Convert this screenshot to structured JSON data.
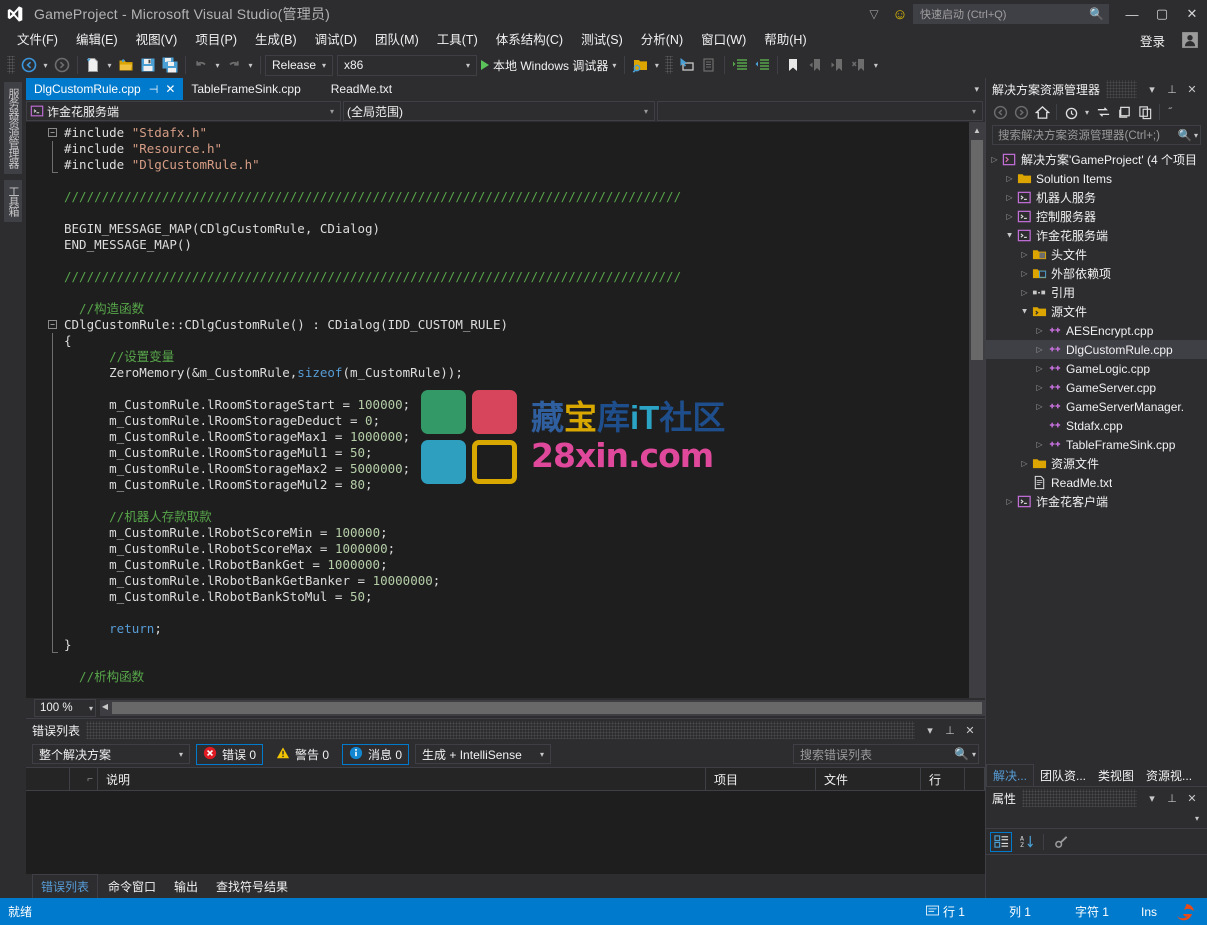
{
  "window": {
    "title": "GameProject - Microsoft Visual Studio(管理员)",
    "logo_name": "visual-studio-logo",
    "minimize": "—",
    "maximize": "▢",
    "close": "✕",
    "feedback_icon": "▽",
    "smiley_icon": "☺"
  },
  "quick_launch": {
    "placeholder": "快速启动 (Ctrl+Q)",
    "icon": "search-icon"
  },
  "menu": {
    "items": [
      "文件(F)",
      "编辑(E)",
      "视图(V)",
      "项目(P)",
      "生成(B)",
      "调试(D)",
      "团队(M)",
      "工具(T)",
      "体系结构(C)",
      "测试(S)",
      "分析(N)",
      "窗口(W)",
      "帮助(H)"
    ],
    "sign_in": "登录"
  },
  "toolbar": {
    "back_icon": "navigate-back-icon",
    "forward_icon": "navigate-forward-icon",
    "new_item_icon": "new-item-icon",
    "open_icon": "open-file-icon",
    "save_icon": "save-icon",
    "save_all_icon": "save-all-icon",
    "undo_icon": "undo-icon",
    "redo_icon": "redo-icon",
    "configuration": "Release",
    "platform": "x86",
    "run_label": "本地 Windows 调试器",
    "find_icon": "find-in-files-icon",
    "cursor_icon": "pointer-select-icon",
    "clipboard_icon": "clipboard-icon",
    "indent_icon": "increase-indent-icon",
    "outdent_icon": "decrease-indent-icon",
    "bookmark_icon": "bookmark-icon",
    "prev_bookmark_icon": "previous-bookmark-icon",
    "next_bookmark_icon": "next-bookmark-icon",
    "clear_bookmark_icon": "clear-bookmarks-icon"
  },
  "left_strip": {
    "tabs": [
      "服务器资源管理器",
      "工具箱"
    ]
  },
  "editor": {
    "tabs": [
      {
        "label": "DlgCustomRule.cpp",
        "active": true,
        "pin": "⊣",
        "close": "✕"
      },
      {
        "label": "TableFrameSink.cpp",
        "active": false
      },
      {
        "label": "ReadMe.txt",
        "active": false
      }
    ],
    "nav_project": "诈金花服务端",
    "nav_scope": "(全局范围)",
    "zoom": "100 %",
    "code_lines": [
      {
        "tokens": [
          {
            "t": "#include ",
            "c": "pp"
          },
          {
            "t": "\"Stdafx.h\"",
            "c": "str"
          }
        ],
        "fold": "open"
      },
      {
        "tokens": [
          {
            "t": "#include ",
            "c": "pp"
          },
          {
            "t": "\"Resource.h\"",
            "c": "str"
          }
        ],
        "bar": true
      },
      {
        "tokens": [
          {
            "t": "#include ",
            "c": "pp"
          },
          {
            "t": "\"DlgCustomRule.h\"",
            "c": "str"
          }
        ],
        "bar": true,
        "barend": true
      },
      {
        "tokens": []
      },
      {
        "tokens": [
          {
            "t": "//////////////////////////////////////////////////////////////////////////////////",
            "c": "com"
          }
        ]
      },
      {
        "tokens": []
      },
      {
        "tokens": [
          {
            "t": "BEGIN_MESSAGE_MAP(CDlgCustomRule, CDialog)",
            "c": "id"
          }
        ]
      },
      {
        "tokens": [
          {
            "t": "END_MESSAGE_MAP()",
            "c": "id"
          }
        ]
      },
      {
        "tokens": []
      },
      {
        "tokens": [
          {
            "t": "//////////////////////////////////////////////////////////////////////////////////",
            "c": "com"
          }
        ]
      },
      {
        "tokens": []
      },
      {
        "tokens": [
          {
            "t": "  //构造函数",
            "c": "com"
          }
        ]
      },
      {
        "tokens": [
          {
            "t": "CDlgCustomRule::CDlgCustomRule() : CDialog(IDD_CUSTOM_RULE)",
            "c": "id"
          }
        ],
        "fold": "open"
      },
      {
        "tokens": [
          {
            "t": "{",
            "c": "id"
          }
        ],
        "bar": true
      },
      {
        "tokens": [
          {
            "t": "      //设置变量",
            "c": "com"
          }
        ],
        "bar": true
      },
      {
        "tokens": [
          {
            "t": "      ZeroMemory(&m_CustomRule,",
            "c": "id"
          },
          {
            "t": "sizeof",
            "c": "kw"
          },
          {
            "t": "(m_CustomRule));",
            "c": "id"
          }
        ],
        "bar": true
      },
      {
        "tokens": [],
        "bar": true
      },
      {
        "tokens": [
          {
            "t": "      m_CustomRule.lRoomStorageStart = ",
            "c": "id"
          },
          {
            "t": "100000",
            "c": "num"
          },
          {
            "t": ";",
            "c": "id"
          }
        ],
        "bar": true
      },
      {
        "tokens": [
          {
            "t": "      m_CustomRule.lRoomStorageDeduct = ",
            "c": "id"
          },
          {
            "t": "0",
            "c": "num"
          },
          {
            "t": ";",
            "c": "id"
          }
        ],
        "bar": true
      },
      {
        "tokens": [
          {
            "t": "      m_CustomRule.lRoomStorageMax1 = ",
            "c": "id"
          },
          {
            "t": "1000000",
            "c": "num"
          },
          {
            "t": ";",
            "c": "id"
          }
        ],
        "bar": true
      },
      {
        "tokens": [
          {
            "t": "      m_CustomRule.lRoomStorageMul1 = ",
            "c": "id"
          },
          {
            "t": "50",
            "c": "num"
          },
          {
            "t": ";",
            "c": "id"
          }
        ],
        "bar": true
      },
      {
        "tokens": [
          {
            "t": "      m_CustomRule.lRoomStorageMax2 = ",
            "c": "id"
          },
          {
            "t": "5000000",
            "c": "num"
          },
          {
            "t": ";",
            "c": "id"
          }
        ],
        "bar": true
      },
      {
        "tokens": [
          {
            "t": "      m_CustomRule.lRoomStorageMul2 = ",
            "c": "id"
          },
          {
            "t": "80",
            "c": "num"
          },
          {
            "t": ";",
            "c": "id"
          }
        ],
        "bar": true
      },
      {
        "tokens": [],
        "bar": true
      },
      {
        "tokens": [
          {
            "t": "      //机器人存款取款",
            "c": "com"
          }
        ],
        "bar": true
      },
      {
        "tokens": [
          {
            "t": "      m_CustomRule.lRobotScoreMin = ",
            "c": "id"
          },
          {
            "t": "100000",
            "c": "num"
          },
          {
            "t": ";",
            "c": "id"
          }
        ],
        "bar": true
      },
      {
        "tokens": [
          {
            "t": "      m_CustomRule.lRobotScoreMax = ",
            "c": "id"
          },
          {
            "t": "1000000",
            "c": "num"
          },
          {
            "t": ";",
            "c": "id"
          }
        ],
        "bar": true
      },
      {
        "tokens": [
          {
            "t": "      m_CustomRule.lRobotBankGet = ",
            "c": "id"
          },
          {
            "t": "1000000",
            "c": "num"
          },
          {
            "t": ";",
            "c": "id"
          }
        ],
        "bar": true
      },
      {
        "tokens": [
          {
            "t": "      m_CustomRule.lRobotBankGetBanker = ",
            "c": "id"
          },
          {
            "t": "10000000",
            "c": "num"
          },
          {
            "t": ";",
            "c": "id"
          }
        ],
        "bar": true
      },
      {
        "tokens": [
          {
            "t": "      m_CustomRule.lRobotBankStoMul = ",
            "c": "id"
          },
          {
            "t": "50",
            "c": "num"
          },
          {
            "t": ";",
            "c": "id"
          }
        ],
        "bar": true
      },
      {
        "tokens": [],
        "bar": true
      },
      {
        "tokens": [
          {
            "t": "      ",
            "c": "id"
          },
          {
            "t": "return",
            "c": "kw"
          },
          {
            "t": ";",
            "c": "id"
          }
        ],
        "bar": true
      },
      {
        "tokens": [
          {
            "t": "}",
            "c": "id"
          }
        ],
        "bar": true,
        "barend": true
      },
      {
        "tokens": []
      },
      {
        "tokens": [
          {
            "t": "  //析构函数",
            "c": "com"
          }
        ]
      }
    ]
  },
  "watermark": {
    "line1_parts": [
      {
        "text": "藏",
        "color": "#2f5f9e"
      },
      {
        "text": "宝",
        "color": "#d8a800"
      },
      {
        "text": "库",
        "color": "#1f4e8c"
      },
      {
        "text": "iT",
        "color": "#2aa3c4"
      },
      {
        "text": "社区",
        "color": "#1f4e8c"
      }
    ],
    "line2": "28xin.com",
    "line2_color": "#e0499b",
    "squares": [
      "#339966",
      "#d6455c",
      "#2f9fc0",
      "#d8a800"
    ]
  },
  "solution_explorer": {
    "title": "解决方案资源管理器",
    "search_placeholder": "搜索解决方案资源管理器(Ctrl+;)",
    "dropdown_icon": "chevron-down-icon",
    "pin_icon": "pin-icon",
    "close_icon": "close-icon",
    "toolbar_icons": [
      "back-icon",
      "forward-icon",
      "home-icon",
      "pending-changes-icon",
      "sync-with-active-document-icon",
      "refresh-icon",
      "show-all-files-icon",
      "properties-icon",
      "overflow-icon"
    ],
    "tree": [
      {
        "indent": 0,
        "twisty": "▷",
        "icon": "solution-icon",
        "label": "解决方案'GameProject' (4 个项目"
      },
      {
        "indent": 1,
        "twisty": "▷",
        "icon": "folder-icon",
        "label": "Solution Items"
      },
      {
        "indent": 1,
        "twisty": "▷",
        "icon": "cpp-project-icon",
        "label": "机器人服务"
      },
      {
        "indent": 1,
        "twisty": "▷",
        "icon": "cpp-project-icon",
        "label": "控制服务器"
      },
      {
        "indent": 1,
        "twisty": "▲",
        "icon": "cpp-project-icon",
        "label": "诈金花服务端"
      },
      {
        "indent": 2,
        "twisty": "▷",
        "icon": "header-folder-icon",
        "label": "头文件"
      },
      {
        "indent": 2,
        "twisty": "▷",
        "icon": "ext-deps-icon",
        "label": "外部依赖项"
      },
      {
        "indent": 2,
        "twisty": "▷",
        "icon": "references-icon",
        "label": "引用"
      },
      {
        "indent": 2,
        "twisty": "▲",
        "icon": "source-folder-icon",
        "label": "源文件"
      },
      {
        "indent": 3,
        "twisty": "▷",
        "icon": "cpp-file-icon",
        "label": "AESEncrypt.cpp"
      },
      {
        "indent": 3,
        "twisty": "▷",
        "icon": "cpp-file-icon",
        "label": "DlgCustomRule.cpp",
        "selected": true
      },
      {
        "indent": 3,
        "twisty": "▷",
        "icon": "cpp-file-icon",
        "label": "GameLogic.cpp"
      },
      {
        "indent": 3,
        "twisty": "▷",
        "icon": "cpp-file-icon",
        "label": "GameServer.cpp"
      },
      {
        "indent": 3,
        "twisty": "▷",
        "icon": "cpp-file-icon",
        "label": "GameServerManager."
      },
      {
        "indent": 3,
        "twisty": "",
        "icon": "cpp-file-icon",
        "label": "Stdafx.cpp"
      },
      {
        "indent": 3,
        "twisty": "▷",
        "icon": "cpp-file-icon",
        "label": "TableFrameSink.cpp"
      },
      {
        "indent": 2,
        "twisty": "▷",
        "icon": "folder-icon",
        "label": "资源文件"
      },
      {
        "indent": 2,
        "twisty": "",
        "icon": "txt-file-icon",
        "label": "ReadMe.txt"
      },
      {
        "indent": 1,
        "twisty": "▷",
        "icon": "cpp-project-icon",
        "label": "诈金花客户端"
      }
    ]
  },
  "right_tabs": [
    {
      "label": "解决...",
      "active": true
    },
    {
      "label": "团队资...",
      "active": false
    },
    {
      "label": "类视图",
      "active": false
    },
    {
      "label": "资源视...",
      "active": false
    }
  ],
  "properties": {
    "title": "属性",
    "categorized_icon": "categorized-view-icon",
    "alphabetical_icon": "alphabetical-sort-icon",
    "events_icon": "property-pages-icon",
    "dropdown_icon": "chevron-down-icon",
    "pin_icon": "pin-icon",
    "close_icon": "close-icon"
  },
  "error_list": {
    "title": "错误列表",
    "scope": "整个解决方案",
    "errors_label": "错误 0",
    "warnings_label": "警告 0",
    "messages_label": "消息 0",
    "build_filter": "生成 + IntelliSense",
    "search_placeholder": "搜索错误列表",
    "columns": [
      "",
      "",
      "说明",
      "项目",
      "文件",
      "行"
    ],
    "rows": [],
    "error_icon": "error-icon",
    "warning_icon": "warning-icon",
    "info-icon": "info-icon"
  },
  "bottom_tabs": [
    {
      "label": "错误列表",
      "active": true
    },
    {
      "label": "命令窗口",
      "active": false
    },
    {
      "label": "输出",
      "active": false
    },
    {
      "label": "查找符号结果",
      "active": false
    }
  ],
  "status_bar": {
    "ready": "就绪",
    "line_icon": "line-indicator-icon",
    "line": "行 1",
    "column": "列 1",
    "character": "字符 1",
    "insert_mode": "Ins",
    "browser_icon": "internet-explorer-icon"
  },
  "colors": {
    "accent": "#007acc",
    "chrome": "#2d2d30",
    "editor_bg": "#1e1e1e",
    "comment": "#57a64a",
    "string": "#d69d85",
    "keyword": "#569cd6",
    "number": "#b5cea8"
  }
}
